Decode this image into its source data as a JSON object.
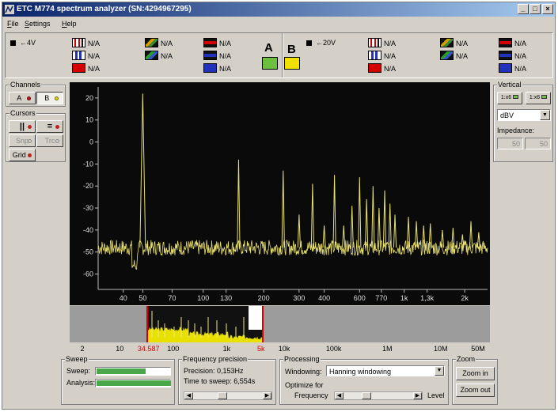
{
  "window": {
    "title": "ETC M774 spectrum analyzer (SN:4294967295)",
    "minimize": "_",
    "maximize": "□",
    "close": "×"
  },
  "menu": [
    "File",
    "Settings",
    "Help"
  ],
  "top_strip": {
    "a_range": "←4V",
    "b_range": "←20V",
    "na": "N/A",
    "a_letter": "A",
    "b_letter": "B",
    "a_color": "#6cbf3f",
    "b_color": "#f0e000"
  },
  "channels": {
    "label": "Channels",
    "a": "A",
    "b": "B"
  },
  "cursors": {
    "label": "Cursors",
    "vertical": "||",
    "horizontal": "=",
    "snap": "Snp",
    "track": "Trc"
  },
  "grid": "Grid",
  "vertical": {
    "label": "Vertical",
    "a_scale": "1:x6",
    "b_scale": "1:x6",
    "unit": "dBV",
    "impedance_label": "Impedance:",
    "impedance_a": "50",
    "impedance_b": "50"
  },
  "overview_labels": [
    "2",
    "10",
    "34.587",
    "100",
    "1k",
    "5k",
    "10k",
    "100k",
    "1M",
    "10M",
    "50M"
  ],
  "sweep": {
    "label": "Sweep",
    "sweep_label": "Sweep:",
    "analysis_label": "Analysis:",
    "sweep_progress": 0.66,
    "analysis_progress": 1.0
  },
  "precision": {
    "label": "Frequency precision",
    "precision_text": "Precision: 0,153Hz",
    "time_text": "Time to sweep: 6,554s"
  },
  "processing": {
    "label": "Processing",
    "windowing_label": "Windowing:",
    "windowing_value": "Hanning windowing",
    "optimize_label": "Optimize for",
    "frequency_label": "Frequency",
    "level_label": "Level"
  },
  "zoom": {
    "label": "Zoom",
    "zoom_in": "Zoom in",
    "zoom_out": "Zoom out"
  },
  "chart_data": {
    "type": "line",
    "x_scale": "log",
    "y_ticks": [
      20,
      10,
      0,
      -10,
      -20,
      -30,
      -40,
      -50,
      -60
    ],
    "x_tick_labels": [
      "40",
      "50",
      "70",
      "100",
      "130",
      "200",
      "300",
      "400",
      "600",
      "770",
      "1k",
      "1,3k",
      "2k"
    ],
    "x_tick_values": [
      40,
      50,
      70,
      100,
      130,
      200,
      300,
      400,
      600,
      770,
      1000,
      1300,
      2000
    ],
    "xlim": [
      30,
      2600
    ],
    "ylim": [
      -67,
      25
    ],
    "noise_floor": -48,
    "peaks": [
      {
        "f": 50,
        "db": 22
      },
      {
        "f": 150,
        "db": -8
      },
      {
        "f": 250,
        "db": -13
      },
      {
        "f": 300,
        "db": -33
      },
      {
        "f": 350,
        "db": -19
      },
      {
        "f": 400,
        "db": -38
      },
      {
        "f": 450,
        "db": -15
      },
      {
        "f": 500,
        "db": -38
      },
      {
        "f": 550,
        "db": -29
      },
      {
        "f": 600,
        "db": -16
      },
      {
        "f": 650,
        "db": -26
      },
      {
        "f": 700,
        "db": -20
      },
      {
        "f": 750,
        "db": -30
      },
      {
        "f": 800,
        "db": -22
      },
      {
        "f": 850,
        "db": -28
      },
      {
        "f": 900,
        "db": -33
      },
      {
        "f": 1050,
        "db": -34
      },
      {
        "f": 1150,
        "db": -36
      },
      {
        "f": 1250,
        "db": -38
      },
      {
        "f": 1350,
        "db": -37
      },
      {
        "f": 1550,
        "db": -40
      },
      {
        "f": 1750,
        "db": -39
      },
      {
        "f": 1950,
        "db": -42
      },
      {
        "f": 2150,
        "db": -36
      },
      {
        "f": 2350,
        "db": -41
      }
    ],
    "line_color": "#e8e070",
    "background": "#0a0a0a"
  }
}
